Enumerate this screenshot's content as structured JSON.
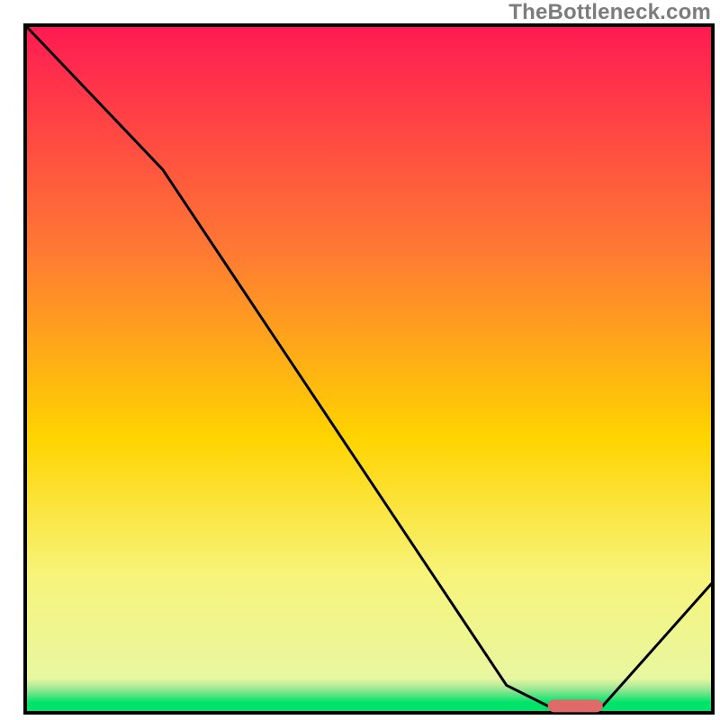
{
  "watermark": "TheBottleneck.com",
  "colors": {
    "top": "#ff1a52",
    "mid_upper": "#ff7a33",
    "mid": "#ffd400",
    "mid_lower": "#f7f47a",
    "green": "#00e36a",
    "border": "#000000",
    "line": "#000000",
    "marker": "#e06a6a"
  },
  "chart_data": {
    "type": "line",
    "title": "",
    "xlabel": "",
    "ylabel": "",
    "xlim": [
      0,
      100
    ],
    "ylim": [
      0,
      100
    ],
    "x": [
      0,
      20,
      70,
      76,
      84,
      100
    ],
    "y": [
      100,
      79,
      4,
      1,
      1,
      19
    ],
    "marker": {
      "x_start": 76,
      "x_end": 84,
      "y": 1
    },
    "gradient_stops": [
      {
        "pos": 0.0,
        "color": "#ff1a52"
      },
      {
        "pos": 0.33,
        "color": "#ff7a33"
      },
      {
        "pos": 0.6,
        "color": "#ffd400"
      },
      {
        "pos": 0.8,
        "color": "#f7f47a"
      },
      {
        "pos": 0.95,
        "color": "#e8f7a0"
      },
      {
        "pos": 0.965,
        "color": "#9fe796"
      },
      {
        "pos": 0.985,
        "color": "#00e36a"
      },
      {
        "pos": 1.0,
        "color": "#00e36a"
      }
    ]
  }
}
